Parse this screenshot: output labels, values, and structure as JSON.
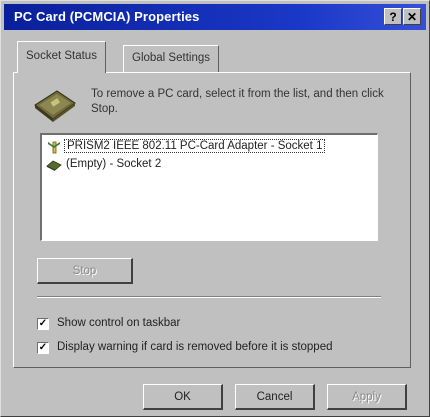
{
  "window": {
    "title": "PC Card (PCMCIA) Properties",
    "help_label": "?",
    "close_label": "✕"
  },
  "tabs": [
    {
      "label": "Socket Status",
      "active": true
    },
    {
      "label": "Global Settings",
      "active": false
    }
  ],
  "socket_status": {
    "instruction": "To remove a PC card, select it from the list, and then click Stop.",
    "icon": "pc-card-icon",
    "sockets": [
      {
        "label": "PRISM2 IEEE 802.11 PC-Card Adapter - Socket 1",
        "icon": "network-adapter-icon",
        "selected": true
      },
      {
        "label": "(Empty) - Socket 2",
        "icon": "empty-slot-icon",
        "selected": false
      }
    ],
    "stop_label": "Stop",
    "show_control_label": "Show control on taskbar",
    "show_control_checked": true,
    "display_warning_label": "Display warning if card is removed before it is stopped",
    "display_warning_checked": true
  },
  "footer": {
    "ok_label": "OK",
    "cancel_label": "Cancel",
    "apply_label": "Apply"
  },
  "colors": {
    "title_bar": "#0a1f9a",
    "face": "#c0c0c0"
  }
}
